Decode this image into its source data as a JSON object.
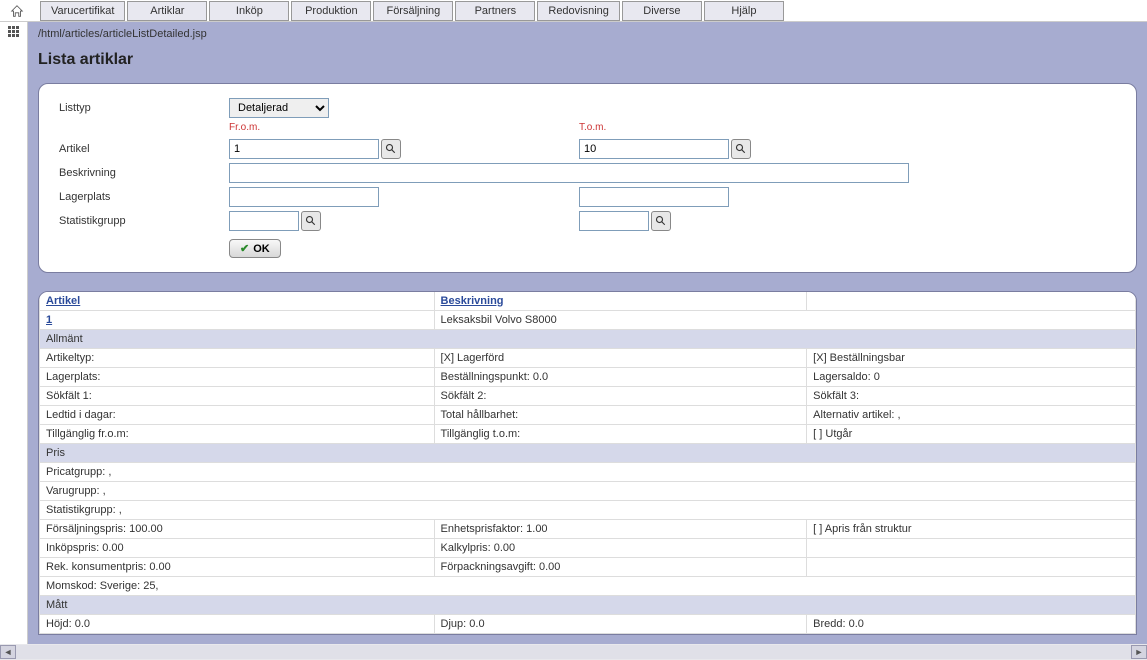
{
  "breadcrumb": "/html/articles/articleListDetailed.jsp",
  "page_title": "Lista artiklar",
  "menu": {
    "items": [
      "Varucertifikat",
      "Artiklar",
      "Inköp",
      "Produktion",
      "Försäljning",
      "Partners",
      "Redovisning",
      "Diverse",
      "Hjälp"
    ]
  },
  "form": {
    "listtyp_label": "Listtyp",
    "listtyp_value": "Detaljerad",
    "from_label": "Fr.o.m.",
    "to_label": "T.o.m.",
    "artikel_label": "Artikel",
    "artikel_from": "1",
    "artikel_to": "10",
    "beskrivning_label": "Beskrivning",
    "beskrivning_value": "",
    "lagerplats_label": "Lagerplats",
    "lagerplats_from": "",
    "lagerplats_to": "",
    "statistikgrupp_label": "Statistikgrupp",
    "statistikgrupp_from": "",
    "statistikgrupp_to": "",
    "ok_label": "OK"
  },
  "table": {
    "col_artikel": "Artikel",
    "col_beskrivning": "Beskrivning",
    "row_article_id": "1",
    "row_article_desc": "Leksaksbil Volvo S8000",
    "section_allmant": "Allmänt",
    "r_artikeltyp_l": "Artikeltyp:",
    "r_lagerford": "[X] Lagerförd",
    "r_bestallningsbar": "[X] Beställningsbar",
    "r_lagerplats_l": "Lagerplats:",
    "r_bestpunkt": "Beställningspunkt: 0.0",
    "r_lagersaldo": "Lagersaldo: 0",
    "r_sokfalt1": "Sökfält 1:",
    "r_sokfalt2": "Sökfält 2:",
    "r_sokfalt3": "Sökfält 3:",
    "r_ledtid": "Ledtid i dagar:",
    "r_hallbarhet": "Total hållbarhet:",
    "r_altartikel": "Alternativ artikel:  ,",
    "r_tillg_from": "Tillgänglig fr.o.m:",
    "r_tillg_tom": "Tillgänglig t.o.m:",
    "r_utgar": "[  ] Utgår",
    "section_pris": "Pris",
    "r_pricatgrupp": "Pricatgrupp:  ,",
    "r_varugrupp": "Varugrupp:  ,",
    "r_statgrupp": "Statistikgrupp:  ,",
    "r_forsaljpris": "Försäljningspris: 100.00",
    "r_enhetsfaktor": "Enhetsprisfaktor: 1.00",
    "r_aprisstruktur": "[  ] Apris från struktur",
    "r_inkopspris": "Inköpspris: 0.00",
    "r_kalkylpris": "Kalkylpris: 0.00",
    "r_rekpris": "Rek. konsumentpris: 0.00",
    "r_forpackavgift": "Förpackningsavgift: 0.00",
    "r_momskod": "Momskod:  Sverige: 25,",
    "section_matt": "Mått",
    "r_hojd": "Höjd: 0.0",
    "r_djup": "Djup: 0.0",
    "r_bredd": "Bredd: 0.0"
  }
}
